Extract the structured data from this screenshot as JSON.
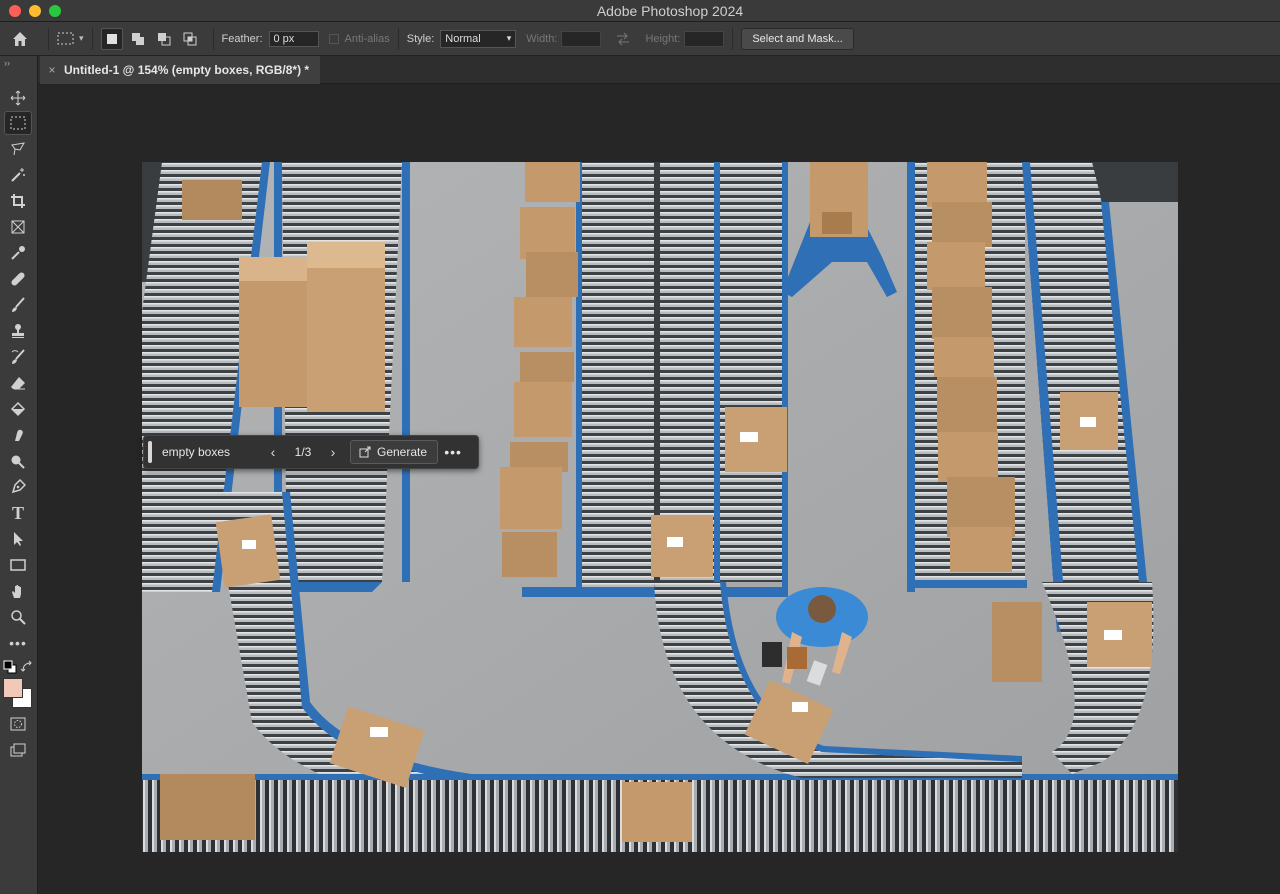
{
  "window": {
    "title": "Adobe Photoshop 2024"
  },
  "options_bar": {
    "feather_label": "Feather:",
    "feather_value": "0 px",
    "antialias_label": "Anti-alias",
    "style_label": "Style:",
    "style_value": "Normal",
    "width_label": "Width:",
    "height_label": "Height:",
    "select_mask_label": "Select and Mask..."
  },
  "document_tab": {
    "title": "Untitled-1 @ 154% (empty boxes, RGB/8*) *"
  },
  "contextual_bar": {
    "prompt": "empty boxes",
    "variation_count": "1/3",
    "generate_label": "Generate"
  },
  "tools": [
    "move-tool",
    "marquee-tool",
    "lasso-tool",
    "magic-wand-tool",
    "crop-tool",
    "frame-tool",
    "eyedropper-tool",
    "healing-tool",
    "brush-tool",
    "clone-stamp-tool",
    "history-brush-tool",
    "eraser-tool",
    "paint-bucket-tool",
    "smudge-tool",
    "dodge-tool",
    "pen-tool",
    "type-tool",
    "path-selection-tool",
    "rectangle-tool",
    "hand-tool",
    "zoom-tool",
    "more-tools"
  ],
  "colors": {
    "foreground": "#f2c9b8",
    "background": "#ffffff",
    "conveyor_blue": "#2f6fb5",
    "box": "#c49a6c"
  }
}
